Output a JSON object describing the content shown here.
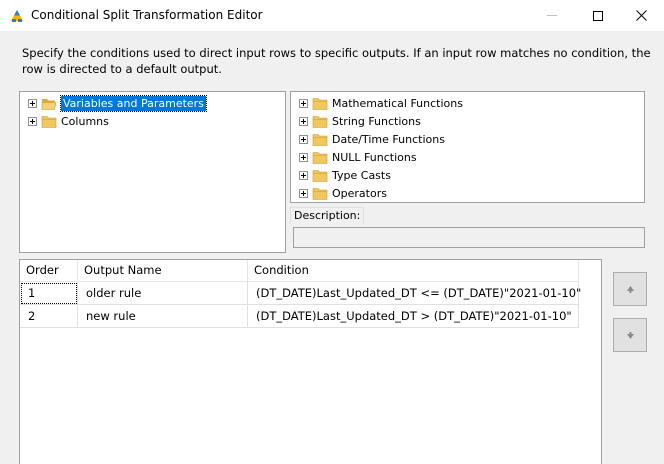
{
  "window": {
    "title": "Conditional Split Transformation Editor"
  },
  "instruction": "Specify the conditions used to direct input rows to specific outputs. If an input row matches no condition, the row is directed to a default output.",
  "left_tree": {
    "items": [
      {
        "label": "Variables and Parameters",
        "selected": true,
        "icon": "open-folder-icon"
      },
      {
        "label": "Columns",
        "selected": false,
        "icon": "folder-icon"
      }
    ]
  },
  "right_tree": {
    "items": [
      {
        "label": "Mathematical Functions",
        "icon": "folder-icon"
      },
      {
        "label": "String Functions",
        "icon": "folder-icon"
      },
      {
        "label": "Date/Time Functions",
        "icon": "folder-icon"
      },
      {
        "label": "NULL Functions",
        "icon": "folder-icon"
      },
      {
        "label": "Type Casts",
        "icon": "folder-icon"
      },
      {
        "label": "Operators",
        "icon": "folder-icon"
      }
    ]
  },
  "description": {
    "label": "Description:",
    "value": ""
  },
  "grid": {
    "columns": [
      "Order",
      "Output Name",
      "Condition"
    ],
    "rows": [
      {
        "order": "1",
        "output_name": "older rule",
        "condition": "(DT_DATE)Last_Updated_DT <= (DT_DATE)\"2021-01-10\""
      },
      {
        "order": "2",
        "output_name": "new rule",
        "condition": "(DT_DATE)Last_Updated_DT > (DT_DATE)\"2021-01-10\""
      }
    ]
  },
  "colors": {
    "selection": "#0078d7",
    "folder": "#e8c15a",
    "window_bg": "#f0f0f0"
  }
}
